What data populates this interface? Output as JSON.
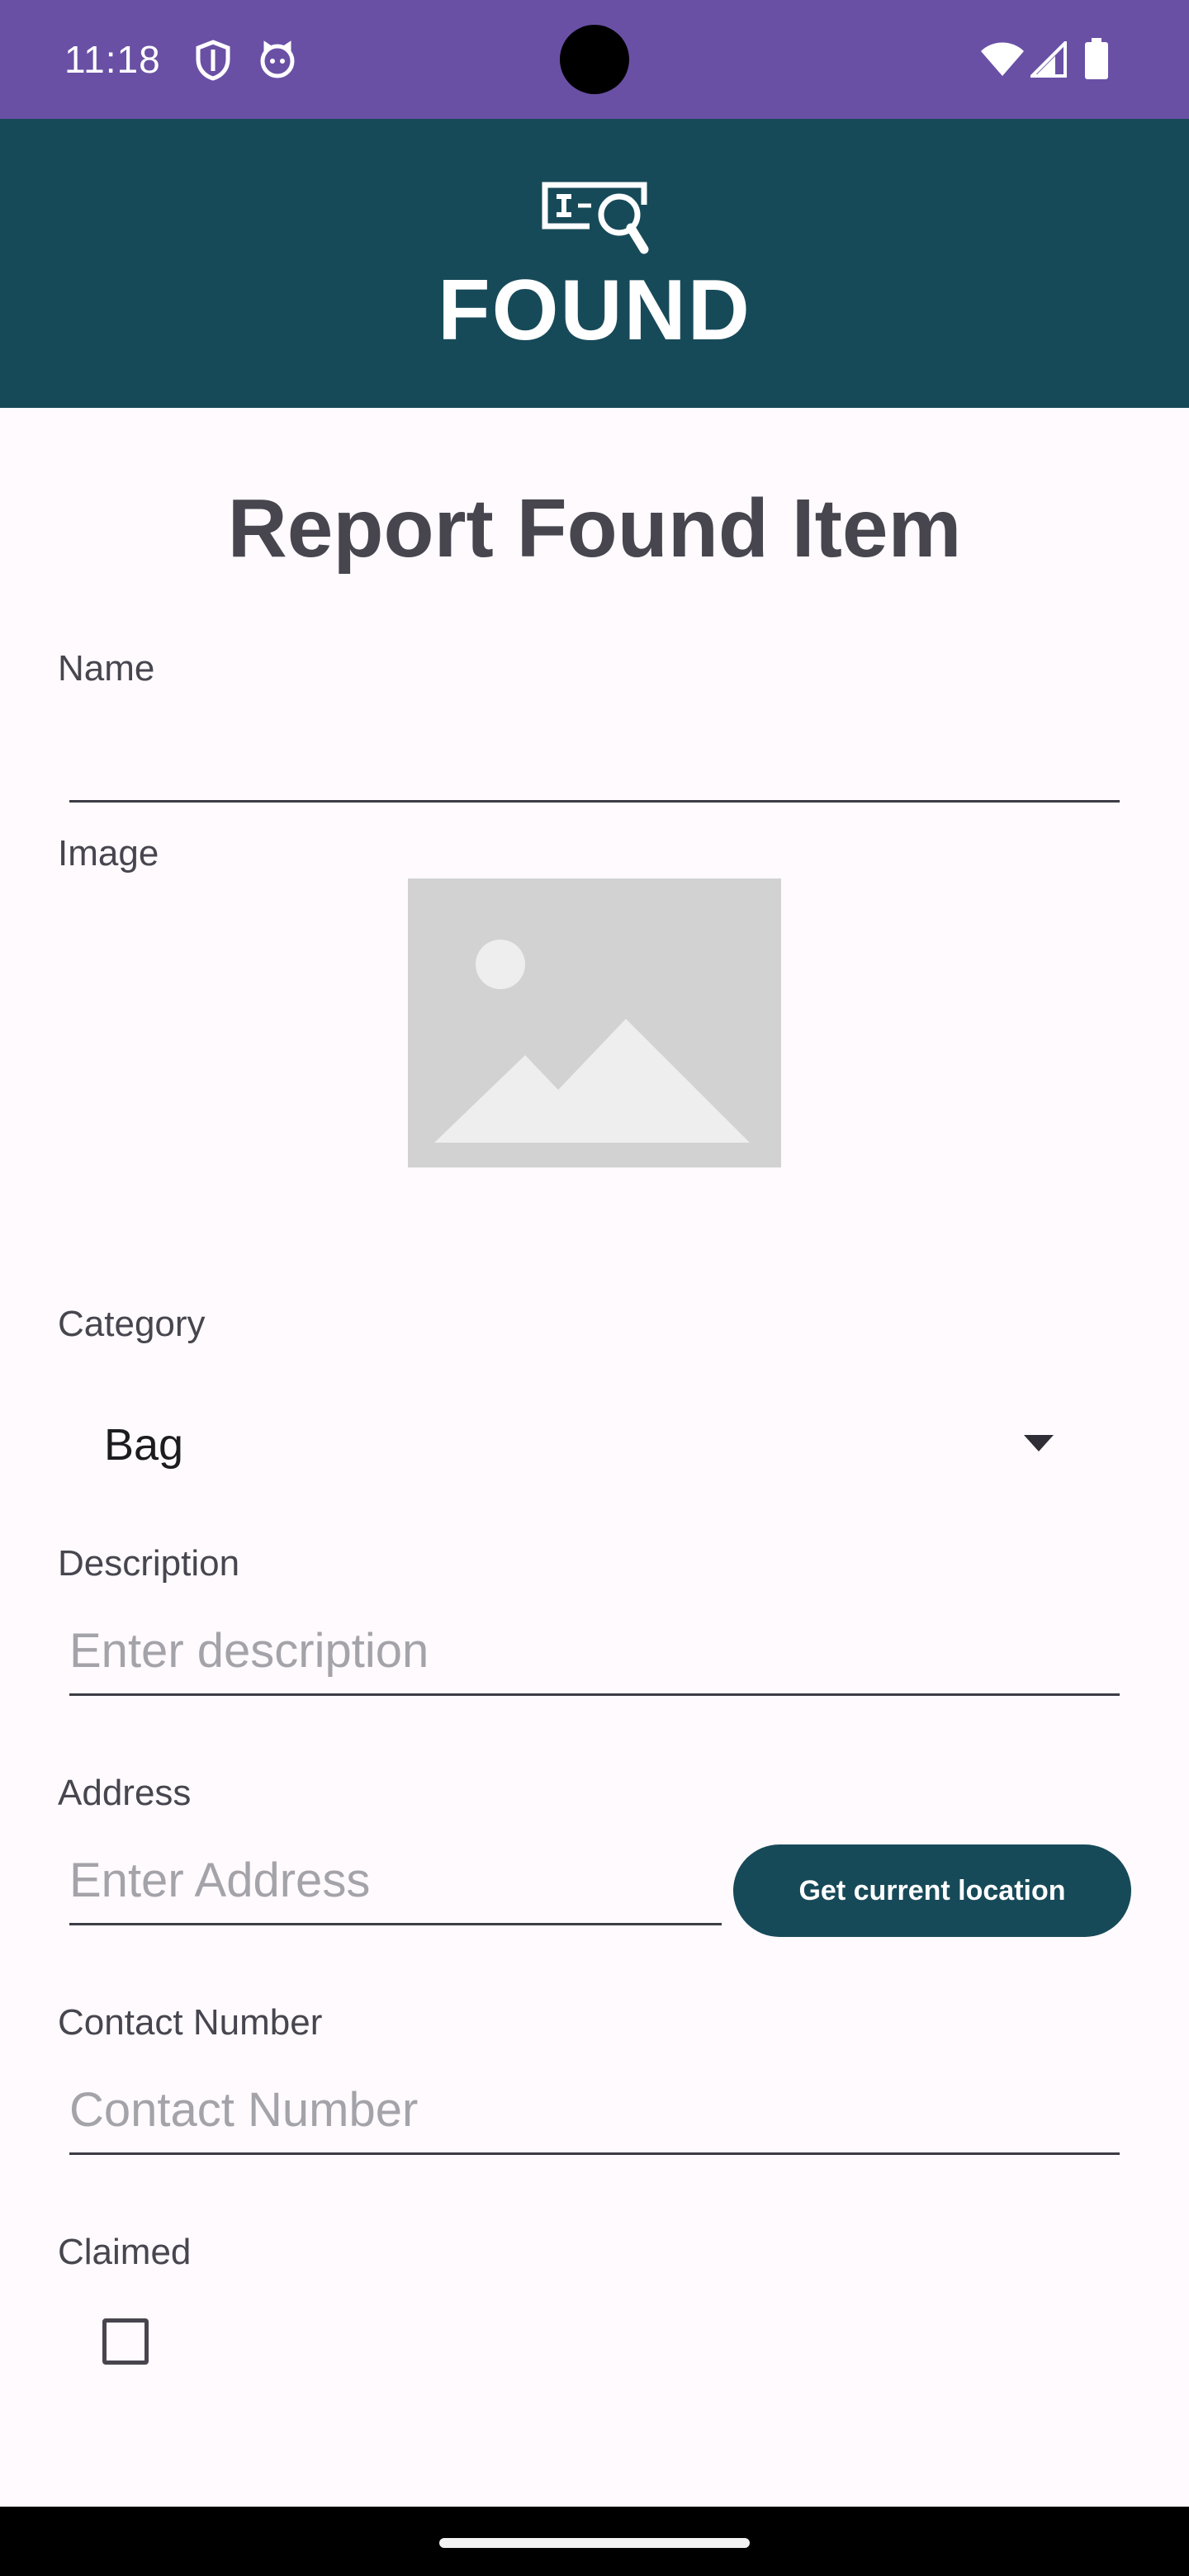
{
  "status_bar": {
    "time": "11:18",
    "background_color": "#6950a5",
    "left_icons": [
      "shield-icon",
      "cat-face-icon"
    ],
    "right_icons": [
      "wifi-icon",
      "cell-signal-icon",
      "battery-icon"
    ]
  },
  "app_bar": {
    "logo_icon": "id-card-search-icon",
    "title": "FOUND",
    "background_color": "#174a59"
  },
  "form": {
    "heading": "Report Found Item",
    "name": {
      "label": "Name",
      "value": "",
      "placeholder": ""
    },
    "image": {
      "label": "Image",
      "placeholder_icon": "image-placeholder-icon"
    },
    "category": {
      "label": "Category",
      "selected": "Bag"
    },
    "description": {
      "label": "Description",
      "value": "",
      "placeholder": "Enter description"
    },
    "address": {
      "label": "Address",
      "value": "",
      "placeholder": "Enter Address"
    },
    "location_button_label": "Get current location",
    "contact": {
      "label": "Contact Number",
      "value": "",
      "placeholder": "Contact Number"
    },
    "claimed": {
      "label": "Claimed",
      "checked": false
    }
  },
  "colors": {
    "primary": "#174a59",
    "status_bar": "#6950a5",
    "page_background": "#fefafd",
    "label_text": "#47464f"
  }
}
